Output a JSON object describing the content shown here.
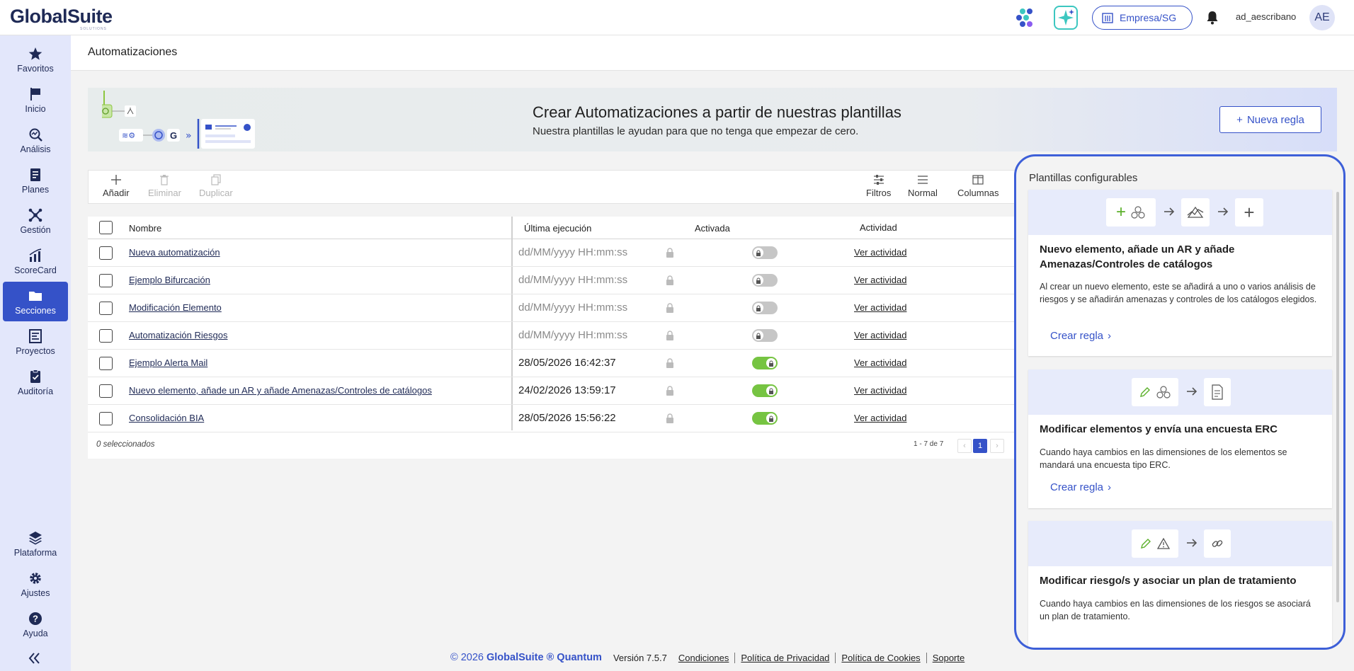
{
  "app": {
    "logo_name": "GlobalSuite",
    "logo_sub": "SOLUTIONS",
    "company_button": "Empresa/SG",
    "username": "ad_aescribano",
    "avatar_initials": "AE",
    "brand_color": "#3552c8"
  },
  "sidebar": {
    "items": [
      {
        "label": "Favoritos",
        "icon": "star-icon"
      },
      {
        "label": "Inicio",
        "icon": "flag-icon"
      },
      {
        "label": "Análisis",
        "icon": "analysis-icon"
      },
      {
        "label": "Planes",
        "icon": "plans-icon"
      },
      {
        "label": "Gestión",
        "icon": "management-icon"
      },
      {
        "label": "ScoreCard",
        "icon": "scorecard-icon"
      },
      {
        "label": "Secciones",
        "icon": "folder-icon",
        "active": true
      },
      {
        "label": "Proyectos",
        "icon": "projects-icon"
      },
      {
        "label": "Auditoría",
        "icon": "audit-icon"
      },
      {
        "label": "Plataforma",
        "icon": "layers-icon"
      },
      {
        "label": "Ajustes",
        "icon": "gear-icon"
      },
      {
        "label": "Ayuda",
        "icon": "help-icon"
      }
    ]
  },
  "page": {
    "title": "Automatizaciones"
  },
  "banner": {
    "title": "Crear Automatizaciones a partir de nuestras plantillas",
    "subtitle": "Nuestra plantillas le ayudan para que no tenga que empezar de cero.",
    "new_rule_button": "Nueva regla"
  },
  "toolbar": {
    "add": "Añadir",
    "delete": "Eliminar",
    "duplicate": "Duplicar",
    "filters": "Filtros",
    "normal": "Normal",
    "columns": "Columnas"
  },
  "table": {
    "headers": {
      "name": "Nombre",
      "last_run": "Última ejecución",
      "enabled": "Activada",
      "activity": "Actividad"
    },
    "rows": [
      {
        "name": "Nueva automatización",
        "last_run": "dd/MM/yyyy HH:mm:ss",
        "enabled": false,
        "activity": "Ver actividad"
      },
      {
        "name": "Ejemplo Bifurcación",
        "last_run": "dd/MM/yyyy HH:mm:ss",
        "enabled": false,
        "activity": "Ver actividad"
      },
      {
        "name": "Modificación Elemento",
        "last_run": "dd/MM/yyyy HH:mm:ss",
        "enabled": false,
        "activity": "Ver actividad"
      },
      {
        "name": "Automatización Riesgos",
        "last_run": "dd/MM/yyyy HH:mm:ss",
        "enabled": false,
        "activity": "Ver actividad"
      },
      {
        "name": "Ejemplo Alerta Mail",
        "last_run": "28/05/2026 16:42:37",
        "enabled": true,
        "activity": "Ver actividad"
      },
      {
        "name": "Nuevo elemento, añade un AR y añade Amenazas/Controles de catálogos",
        "last_run": "24/02/2026 13:59:17",
        "enabled": true,
        "activity": "Ver actividad"
      },
      {
        "name": "Consolidación BIA",
        "last_run": "28/05/2026 15:56:22",
        "enabled": true,
        "activity": "Ver actividad"
      }
    ],
    "selected_text": "0 seleccionados",
    "pager_text": "1 - 7 de 7",
    "current_page": "1"
  },
  "templates": {
    "title": "Plantillas configurables",
    "cards": [
      {
        "title": "Nuevo elemento, añade un AR y añade Amenazas/Controles de catálogos",
        "description": "Al crear un nuevo elemento, este se añadirá a uno o varios análisis de riesgos y se añadirán amenazas y controles de los catálogos elegidos.",
        "action": "Crear regla"
      },
      {
        "title": "Modificar elementos y envía una encuesta ERC",
        "description": "Cuando haya cambios en las dimensiones de los elementos se mandará una encuesta tipo ERC.",
        "action": "Crear regla"
      },
      {
        "title": "Modificar riesgo/s y asociar un plan de tratamiento",
        "description": "Cuando haya cambios en las dimensiones de los riesgos se asociará un plan de tratamiento.",
        "action": "Crear regla"
      }
    ]
  },
  "footer": {
    "copyright_prefix": "© 2026 ",
    "copyright_brand": "GlobalSuite ® Quantum",
    "version": "Versión 7.5.7",
    "links": [
      "Condiciones",
      "Política de Privacidad",
      "Política de Cookies",
      "Soporte"
    ]
  }
}
